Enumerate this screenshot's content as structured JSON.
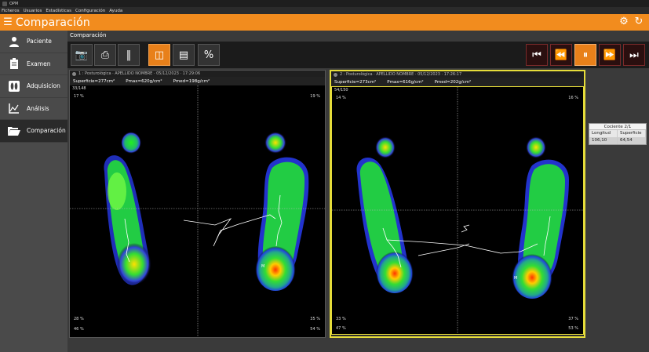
{
  "app": {
    "window_title": "OPM",
    "screen_title": "Comparación"
  },
  "menu": [
    "Ficheros",
    "Usuarios",
    "Estadísticas",
    "Configuración",
    "Ayuda"
  ],
  "sidebar": {
    "items": [
      {
        "label": "Paciente",
        "icon": "person-icon"
      },
      {
        "label": "Examen",
        "icon": "clipboard-icon"
      },
      {
        "label": "Adquisicion",
        "icon": "footprints-icon"
      },
      {
        "label": "Análisis",
        "icon": "chart-icon"
      },
      {
        "label": "Comparación",
        "icon": "folder-open-icon",
        "active": true
      }
    ]
  },
  "breadcrumb": "Comparación",
  "panels": [
    {
      "title": "1 : Posturológica · APELLIDO NOMBRE · 05/12/2023 · 17:29:06",
      "superficie": "Superficie=277cm²",
      "pmax": "Pmax=620g/cm²",
      "pmed": "Pmed=198g/cm²",
      "frame": "33/148",
      "tl": "17 %",
      "tr": "19 %",
      "bl1": "28 %",
      "br1": "35 %",
      "bl2": "46 %",
      "br2": "54 %"
    },
    {
      "title": "2 : Posturológica · APELLIDO NOMBRE · 05/12/2023 · 17:26:17",
      "superficie": "Superficie=273cm²",
      "pmax": "Pmax=616g/cm²",
      "pmed": "Pmed=202g/cm²",
      "frame": "54/150",
      "tl": "14 %",
      "tr": "16 %",
      "bl1": "33 %",
      "br1": "37 %",
      "bl2": "47 %",
      "br2": "53 %"
    }
  ],
  "ratio": {
    "title": "Cociente 2/1",
    "headers": [
      "Longitud",
      "Superficie"
    ],
    "values": [
      "106,10",
      "64,54"
    ]
  },
  "colors": {
    "accent": "#f28c1e",
    "selected_border": "#e6dd3a"
  }
}
